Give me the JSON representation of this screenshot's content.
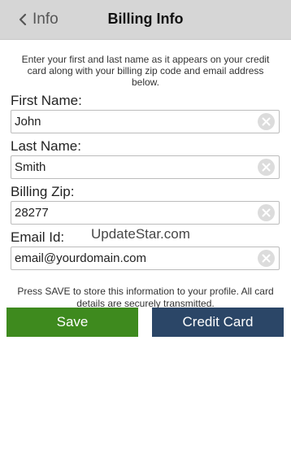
{
  "header": {
    "back_label": "Info",
    "title": "Billing Info"
  },
  "intro_text": "Enter your first and last name as it appears on your credit card along with your billing zip code and email address below.",
  "fields": [
    {
      "label": "First Name:",
      "value": "John"
    },
    {
      "label": "Last Name:",
      "value": "Smith"
    },
    {
      "label": "Billing Zip:",
      "value": "28277"
    },
    {
      "label": "Email Id:",
      "value": "email@yourdomain.com"
    }
  ],
  "watermark": "UpdateStar.com",
  "note_text": "Press SAVE to store this information to your profile. All card details are securely transmitted.",
  "buttons": {
    "save_label": "Save",
    "credit_card_label": "Credit Card"
  },
  "colors": {
    "header_bg": "#d6d6d6",
    "save_button": "#3e8a1e",
    "credit_card_button": "#2b4667"
  },
  "icons": {
    "back": "chevron-left-icon",
    "clear": "close-icon"
  }
}
